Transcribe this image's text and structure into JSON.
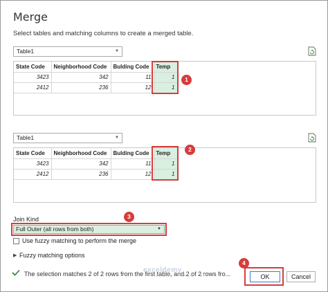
{
  "dialog": {
    "title": "Merge",
    "subtitle": "Select tables and matching columns to create a merged table."
  },
  "top_table": {
    "selected": "Table1",
    "columns": [
      "State Code",
      "Neighborhood Code",
      "Bulding Code",
      "Temp"
    ],
    "rows": [
      [
        "3423",
        "342",
        "11",
        "1"
      ],
      [
        "2412",
        "236",
        "12",
        "1"
      ]
    ]
  },
  "bottom_table": {
    "selected": "Table1",
    "columns": [
      "State Code",
      "Neighborhood Code",
      "Bulding Code",
      "Temp"
    ],
    "rows": [
      [
        "3423",
        "342",
        "11",
        "1"
      ],
      [
        "2412",
        "236",
        "12",
        "1"
      ]
    ]
  },
  "join": {
    "label": "Join Kind",
    "selected": "Full Outer (all rows from both)"
  },
  "fuzzy": {
    "checkbox_label": "Use fuzzy matching to perform the merge",
    "options_label": "Fuzzy matching options"
  },
  "status": {
    "text": "The selection matches 2 of 2 rows from the first table, and 2 of 2 rows fro..."
  },
  "buttons": {
    "ok": "OK",
    "cancel": "Cancel"
  },
  "annotations": [
    "1",
    "2",
    "3",
    "4"
  ],
  "watermark": {
    "name": "exceldemy",
    "tagline": "EXCEL · DATA · BI"
  },
  "colors": {
    "highlight": "#d63c3c",
    "selected_column": "#d9efe0"
  }
}
